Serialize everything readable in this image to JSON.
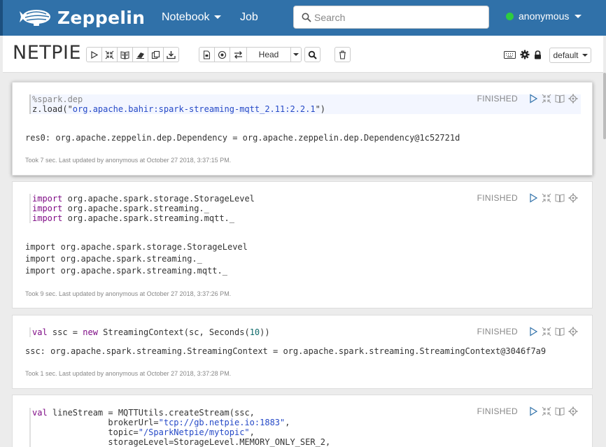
{
  "navbar": {
    "brand": "Zeppelin",
    "menu_notebook": "Notebook",
    "menu_job": "Job",
    "search_placeholder": "Search",
    "user": "anonymous"
  },
  "notebook": {
    "title": "NETPIE",
    "revision_label": "Head",
    "interpreter_binding": "default"
  },
  "paragraphs": [
    {
      "status": "FINISHED",
      "code_lines": [
        "%spark.dep",
        "z.load(\"org.apache.bahir:spark-streaming-mqtt_2.11:2.2.1\")"
      ],
      "output": [
        "res0: org.apache.zeppelin.dep.Dependency = org.apache.zeppelin.dep.Dependency@1c52721d"
      ],
      "footer": "Took 7 sec. Last updated by anonymous at October 27 2018, 3:37:15 PM."
    },
    {
      "status": "FINISHED",
      "code_lines": [
        "import org.apache.spark.storage.StorageLevel",
        "import org.apache.spark.streaming._",
        "import org.apache.spark.streaming.mqtt._"
      ],
      "output": [
        "import org.apache.spark.storage.StorageLevel",
        "import org.apache.spark.streaming._",
        "import org.apache.spark.streaming.mqtt._"
      ],
      "footer": "Took 9 sec. Last updated by anonymous at October 27 2018, 3:37:26 PM."
    },
    {
      "status": "FINISHED",
      "code_lines": [
        "val ssc = new StreamingContext(sc, Seconds(10))"
      ],
      "output": [
        "ssc: org.apache.spark.streaming.StreamingContext = org.apache.spark.streaming.StreamingContext@3046f7a9"
      ],
      "footer": "Took 1 sec. Last updated by anonymous at October 27 2018, 3:37:28 PM."
    },
    {
      "status": "FINISHED",
      "code_lines": [
        "val lineStream = MQTTUtils.createStream(ssc,",
        "               brokerUrl=\"tcp://gb.netpie.io:1883\",",
        "               topic=\"/SparkNetpie/mytopic\",",
        "               storageLevel=StorageLevel.MEMORY_ONLY_SER_2,"
      ]
    }
  ],
  "colors": {
    "navbar": "#3071a9",
    "keyword": "#7f0c86",
    "string": "#2549c7",
    "online": "#2ecc40"
  }
}
